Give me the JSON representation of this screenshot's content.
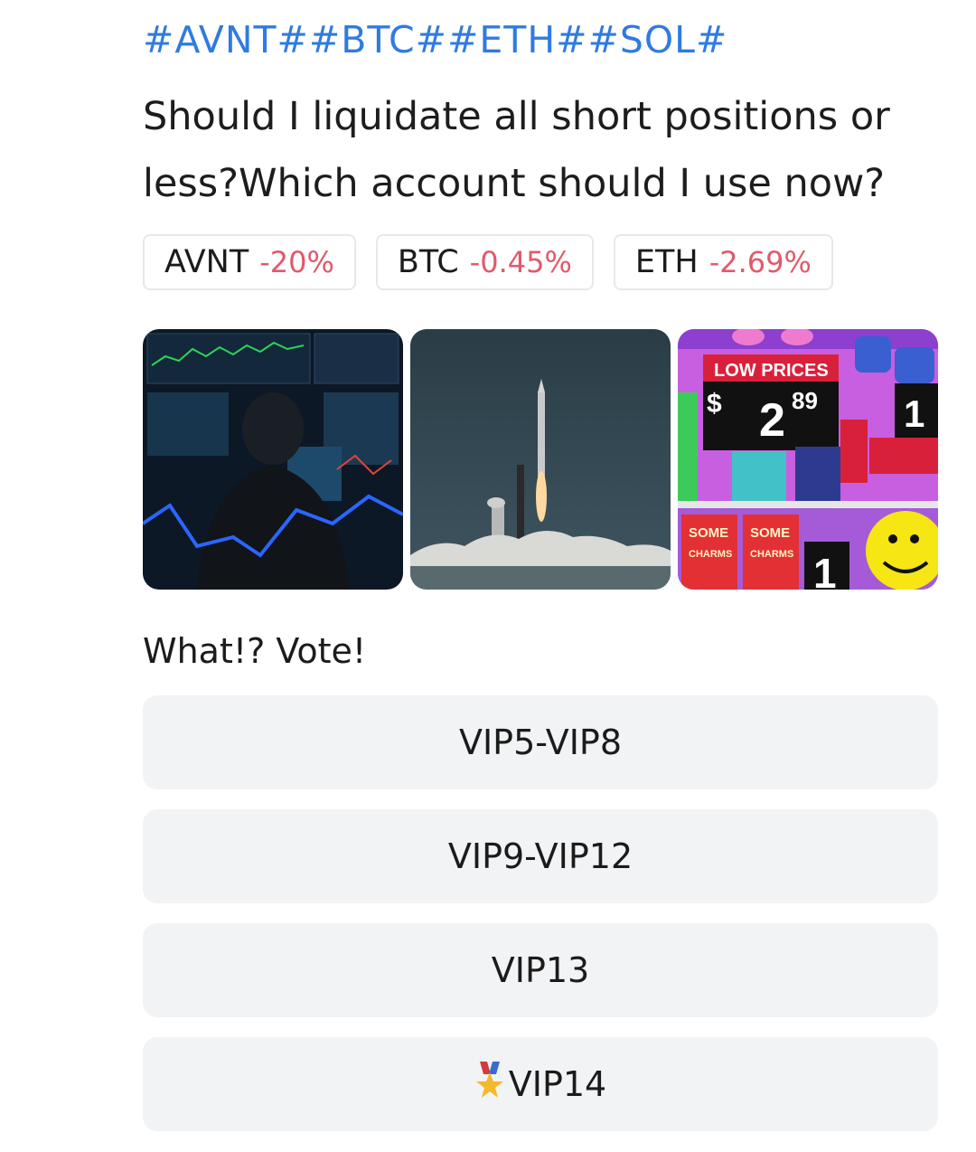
{
  "post": {
    "hashtags": [
      "#AVNT#",
      "#BTC#",
      "#ETH#",
      "#SOL#"
    ],
    "question": "Should I liquidate all short positions or less?Which account should I use now?"
  },
  "tickers": [
    {
      "symbol": "AVNT",
      "change": "-20%"
    },
    {
      "symbol": "BTC",
      "change": "-0.45%"
    },
    {
      "symbol": "ETH",
      "change": "-2.69%"
    }
  ],
  "images": [
    {
      "icon": "trader-at-monitors-image"
    },
    {
      "icon": "rocket-launch-image"
    },
    {
      "icon": "grocery-shelf-cartoon-image",
      "sign_text": "LOW PRICES",
      "price_dollar": "$",
      "price_main": "2",
      "price_cents": "89",
      "brand_1": "SOME",
      "brand_1b": "CHARMS",
      "big_number": "1"
    }
  ],
  "poll": {
    "title": "What!? Vote!",
    "options": [
      {
        "label": "VIP5-VIP8"
      },
      {
        "label": "VIP9-VIP12"
      },
      {
        "label": "VIP13"
      },
      {
        "label": "VIP14",
        "icon": "medal-icon"
      }
    ]
  },
  "colors": {
    "hashtag": "#2f7be0",
    "negative_change": "#e05a6c",
    "option_bg": "#f2f3f5"
  }
}
